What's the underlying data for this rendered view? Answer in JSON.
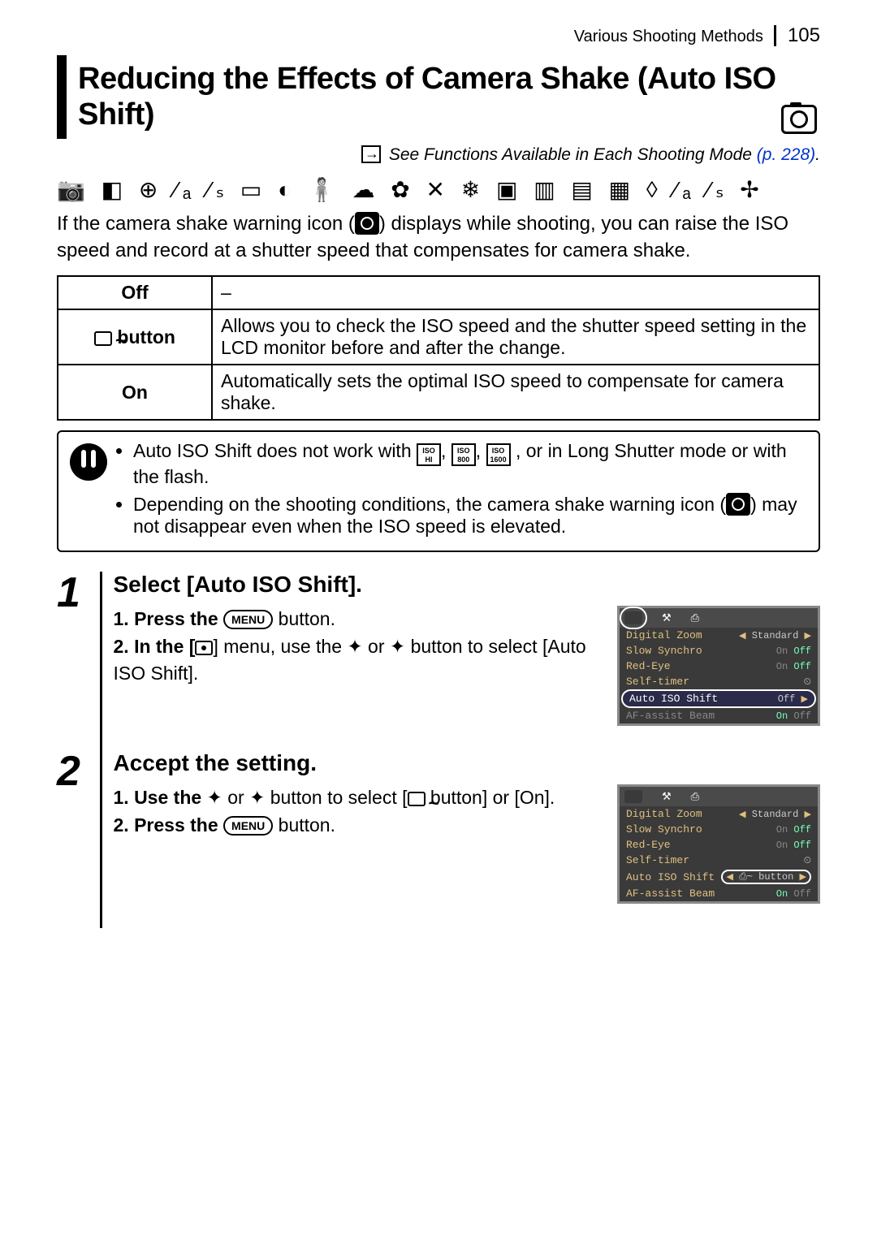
{
  "header": {
    "section": "Various Shooting Methods",
    "page_number": "105"
  },
  "title": "Reducing the Effects of Camera Shake (Auto ISO Shift)",
  "see_link": {
    "text": "See Functions Available in Each Shooting Mode ",
    "ref": "(p. 228)"
  },
  "intro": {
    "part1": "If the camera shake warning icon (",
    "part2": ") displays while shooting, you can raise the ISO speed and record at a shutter speed that compensates for camera shake."
  },
  "options": {
    "off": {
      "label": "Off",
      "desc": "–"
    },
    "button": {
      "label": " button",
      "desc": "Allows you to check the ISO speed and the shutter speed setting in the LCD monitor before and after the change."
    },
    "on": {
      "label": "On",
      "desc": "Automatically sets the optimal ISO speed to compensate for camera shake."
    }
  },
  "warnings": {
    "item1a": "Auto ISO Shift does not work with ",
    "item1b": ", or in Long Shutter mode or with the flash.",
    "item2a": "Depending on the shooting conditions, the camera shake warning icon (",
    "item2b": ") may not disappear even when the ISO speed is elevated."
  },
  "iso_badges": {
    "hi": "ISO\nHI",
    "b800": "ISO\n800",
    "b1600": "ISO\n1600"
  },
  "steps": [
    {
      "num": "1",
      "title": "Select [Auto ISO Shift].",
      "sub1a": "1. Press the ",
      "sub1b": " button.",
      "sub2a": "2. In the [",
      "sub2b": "] menu, use the ",
      "sub2c": " or ",
      "sub2d": " button to select [Auto ISO Shift].",
      "screen": {
        "rows": [
          {
            "lbl": "Digital Zoom",
            "val_on": "",
            "val_mid": "Standard",
            "val_off": ""
          },
          {
            "lbl": "Slow Synchro",
            "val_on": "On",
            "val_off": "Off",
            "off_selected": true
          },
          {
            "lbl": "Red-Eye",
            "val_on": "On",
            "val_off": "Off",
            "off_selected": true
          },
          {
            "lbl": "Self-timer",
            "val_on": "",
            "val_mid": "⏲",
            "val_off": ""
          }
        ],
        "highlight": {
          "lbl": "Auto ISO Shift",
          "val": "Off"
        },
        "after": {
          "lbl": "AF-assist Beam",
          "val_on": "On",
          "val_off": "Off",
          "on_selected": true
        }
      }
    },
    {
      "num": "2",
      "title": "Accept the setting.",
      "sub1a": "1. Use the ",
      "sub1b": " or ",
      "sub1c": " button to select [",
      "sub1d": " button] or [On].",
      "sub2a": "2. Press the ",
      "sub2b": " button.",
      "screen": {
        "rows": [
          {
            "lbl": "Digital Zoom",
            "val_mid": "Standard"
          },
          {
            "lbl": "Slow Synchro",
            "val_on": "On",
            "val_off": "Off",
            "off_selected": true
          },
          {
            "lbl": "Red-Eye",
            "val_on": "On",
            "val_off": "Off",
            "off_selected": true
          },
          {
            "lbl": "Self-timer",
            "val_mid": "⏲"
          }
        ],
        "highlight": {
          "lbl": "Auto ISO Shift",
          "val": "⎙~ button"
        },
        "after": {
          "lbl": "AF-assist Beam",
          "val_on": "On",
          "val_off": "Off",
          "on_selected": true
        }
      }
    }
  ],
  "menu_button_label": "MENU",
  "arrows": {
    "up": "✦",
    "down": "✦",
    "left": "✦",
    "right": "✦"
  }
}
